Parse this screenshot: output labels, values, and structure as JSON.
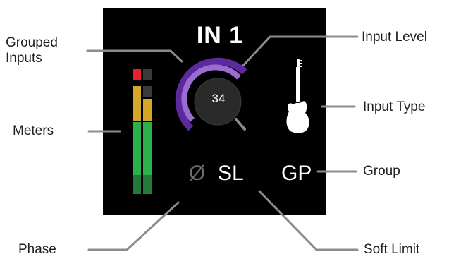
{
  "channel": {
    "title": "IN 1",
    "input_level": "34",
    "phase_symbol": "Ø",
    "soft_limit": "SL",
    "group": "GP",
    "input_type_icon": "electric-guitar-icon"
  },
  "callouts": {
    "grouped_inputs": [
      "Grouped",
      "Inputs"
    ],
    "input_level": "Input Level",
    "meters": "Meters",
    "input_type": "Input Type",
    "group": "Group",
    "phase": "Phase",
    "soft_limit": "Soft Limit"
  },
  "colors": {
    "panel": "#000000",
    "leader_line": "#8c8c8c",
    "ring_dark": "#5a2a9e",
    "ring_light": "#9b6cd0",
    "meter_clip": "#e8202a",
    "meter_high": "#d4a62a",
    "meter_low": "#2bb24c",
    "meter_off_low": "#1f4d2a"
  }
}
